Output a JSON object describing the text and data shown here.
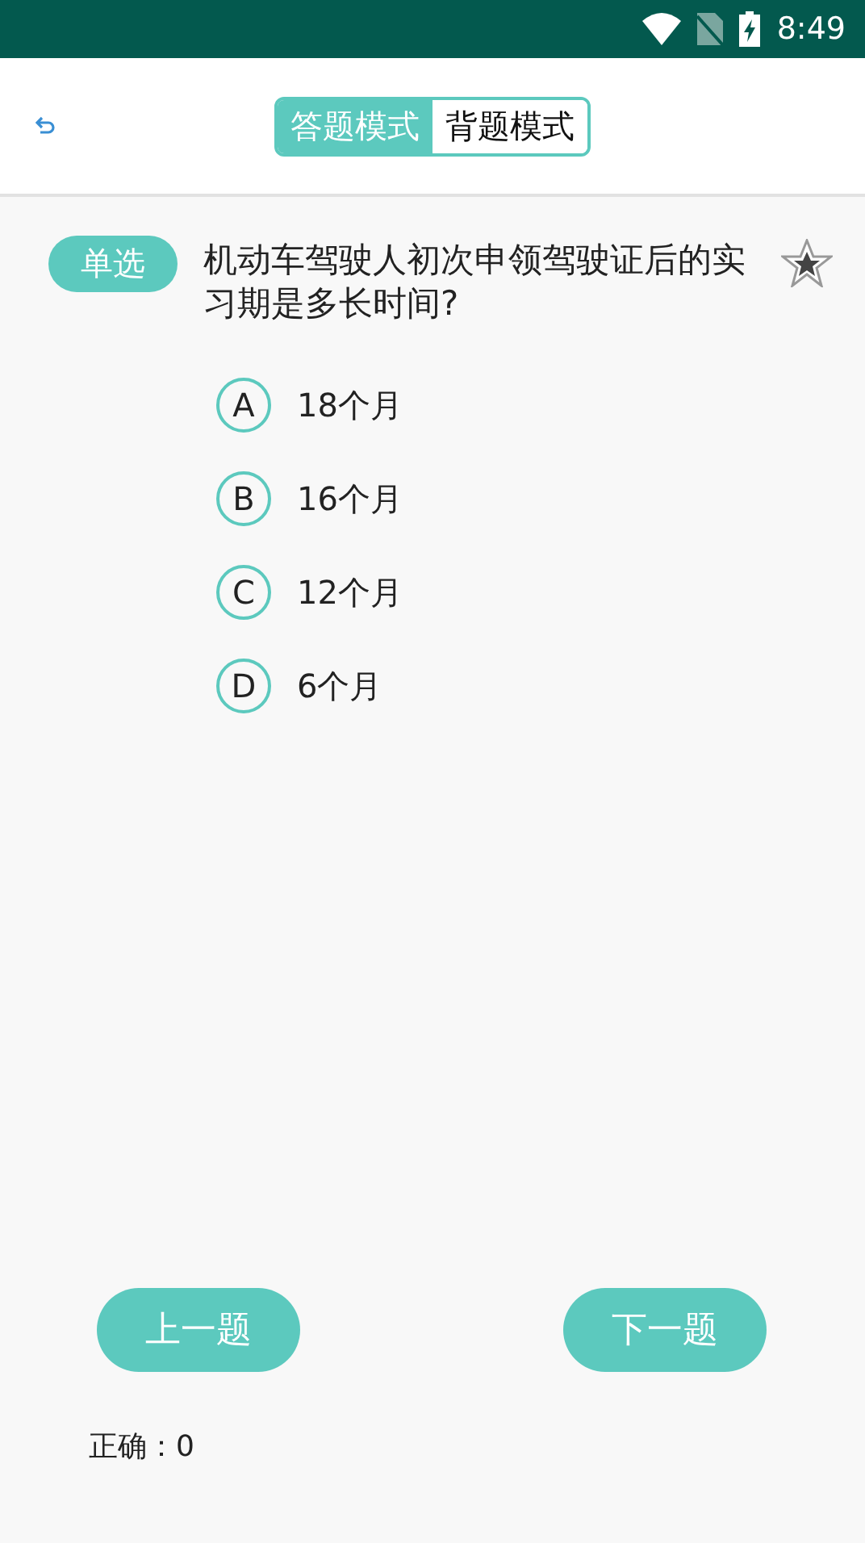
{
  "status_bar": {
    "time": "8:49"
  },
  "header": {
    "modes": [
      {
        "label": "答题模式",
        "selected": true
      },
      {
        "label": "背题模式",
        "selected": false
      }
    ]
  },
  "question": {
    "type_badge": "单选",
    "text": "机动车驾驶人初次申领驾驶证后的实习期是多长时间?",
    "starred": true,
    "options": [
      {
        "letter": "A",
        "text": "18个月",
        "selected": false
      },
      {
        "letter": "B",
        "text": "16个月",
        "selected": false
      },
      {
        "letter": "C",
        "text": "12个月",
        "selected": false
      },
      {
        "letter": "D",
        "text": "6个月",
        "selected": false
      }
    ]
  },
  "buttons": {
    "previous": "上一题",
    "next": "下一题"
  },
  "score": "正确：0"
}
